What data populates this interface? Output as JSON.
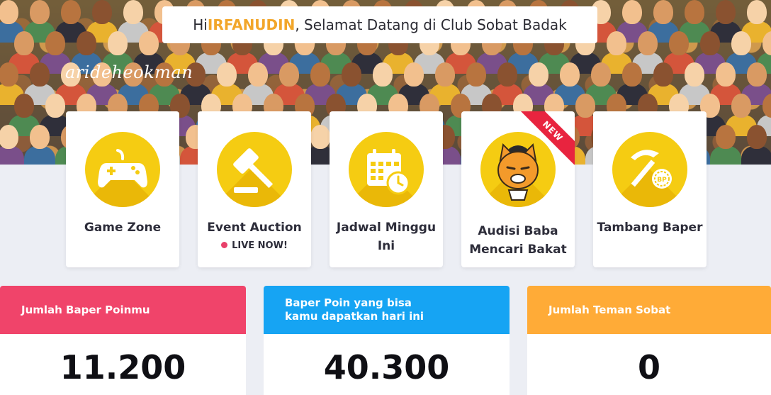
{
  "greeting": {
    "prefix": "Hi ",
    "name": "IRFANUDIN",
    "suffix": ", Selamat Datang di Club Sobat Badak"
  },
  "signature": "arideheokman",
  "menu": [
    {
      "label": "Game Zone",
      "icon": "gamepad-icon"
    },
    {
      "label": "Event Auction",
      "icon": "gavel-icon",
      "status": "LIVE NOW!"
    },
    {
      "label": "Jadwal Minggu Ini",
      "icon": "calendar-clock-icon"
    },
    {
      "label": "Audisi Baba Mencari Bakat",
      "icon": "cat-mascot-icon",
      "badge": "NEW"
    },
    {
      "label": "Tambang Baper",
      "icon": "pickaxe-coin-icon"
    }
  ],
  "stats": [
    {
      "title": "Jumlah Baper Poinmu",
      "value": "11.200",
      "color": "#f0446a"
    },
    {
      "title": "Baper Poin yang bisa kamu dapatkan hari ini",
      "value": "40.300",
      "color": "#16a4f3"
    },
    {
      "title": "Jumlah Teman Sobat",
      "value": "0",
      "color": "#ffab37"
    }
  ],
  "colors": {
    "accent": "#f2a62a",
    "icon_circle": "#f5cc12",
    "live_dot": "#e8406a",
    "new_ribbon": "#e8243f"
  }
}
